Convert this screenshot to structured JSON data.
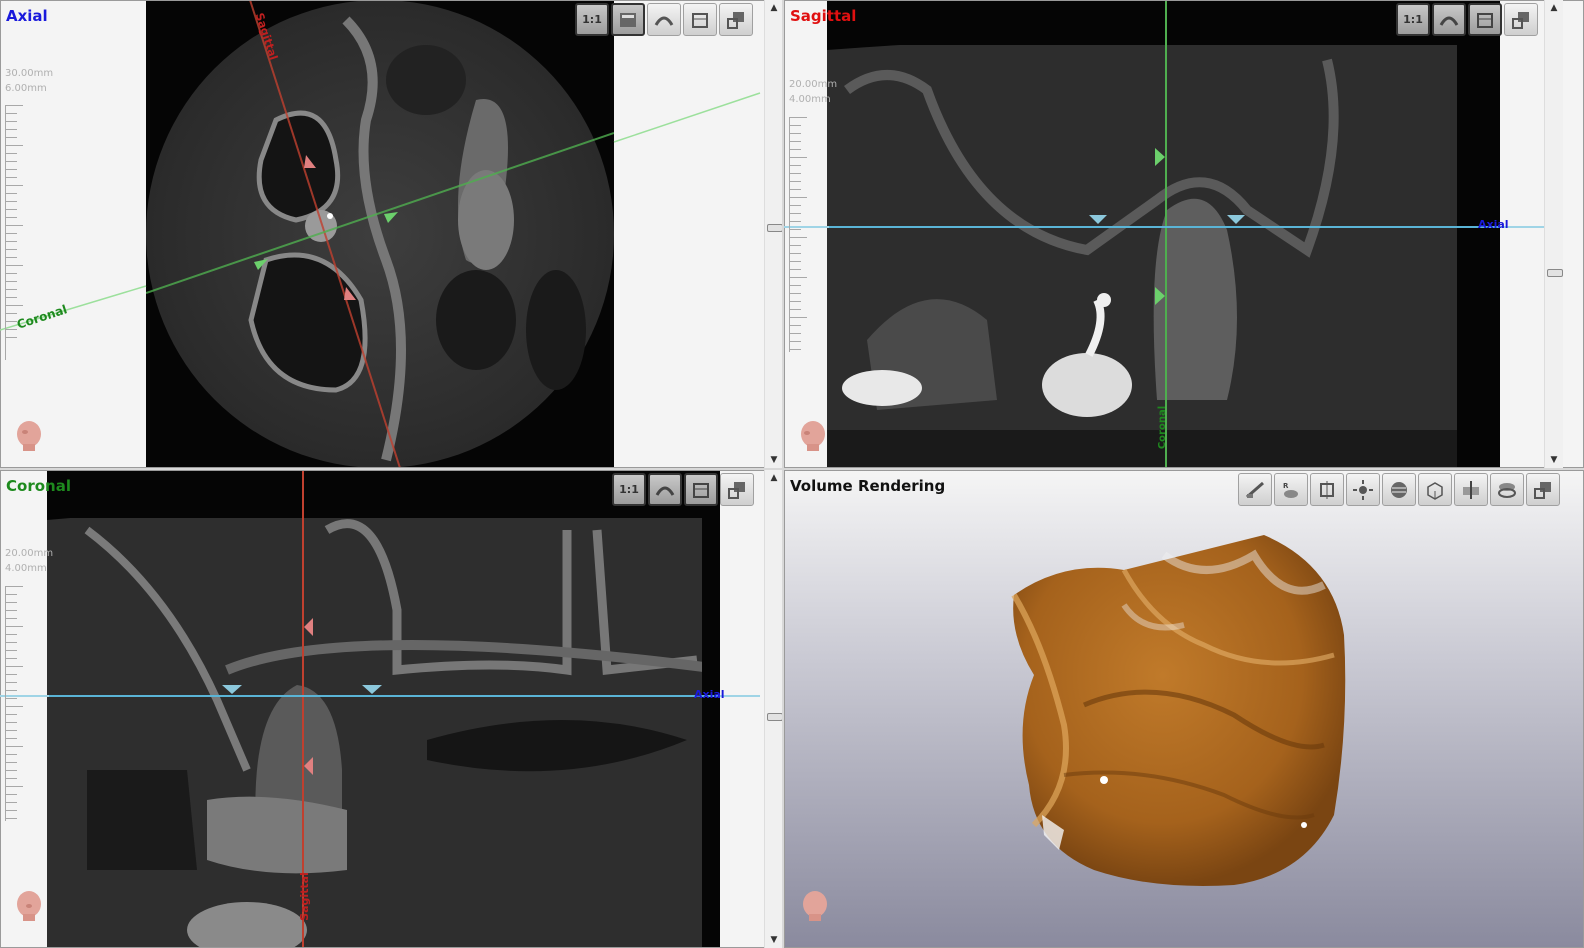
{
  "views": {
    "axial": {
      "title": "Axial",
      "title_color": "#1a1adc",
      "scale_width": "30.00mm",
      "scale_height": "6.00mm"
    },
    "sagittal": {
      "title": "Sagittal",
      "title_color": "#e01010",
      "scale_width": "20.00mm",
      "scale_height": "4.00mm"
    },
    "coronal": {
      "title": "Coronal",
      "title_color": "#1e8a1e",
      "scale_width": "20.00mm",
      "scale_height": "4.00mm"
    },
    "volume": {
      "title": "Volume Rendering",
      "title_color": "#111111"
    }
  },
  "line_labels": {
    "sagittal": "Sagittal",
    "coronal": "Coronal",
    "axial": "Axial"
  },
  "toolbar": {
    "zoom_1to1": "1:1"
  },
  "icons": {
    "head": "head-orientation-icon",
    "scroll_up": "▲",
    "scroll_down": "▼"
  },
  "colors": {
    "sagittal_line": "#c0402f",
    "coronal_line": "#4fae4f",
    "axial_line": "#5ab4d6",
    "bone_render": "#b06d22"
  }
}
